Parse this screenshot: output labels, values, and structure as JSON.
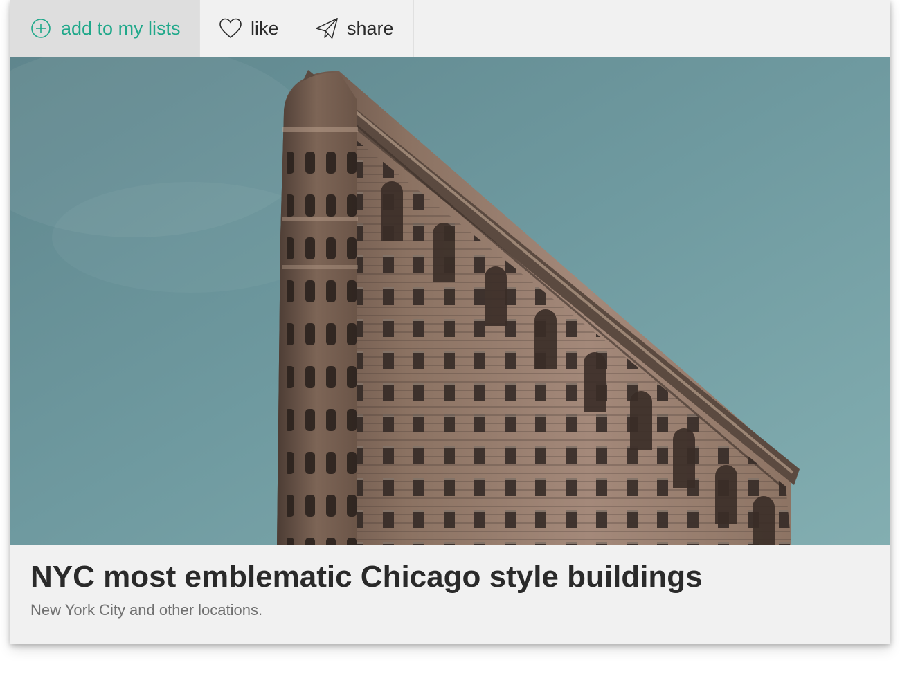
{
  "toolbar": {
    "add_label": "add to my lists",
    "add_icon": "plus-circle-icon",
    "like_label": "like",
    "like_icon": "heart-icon",
    "share_label": "share",
    "share_icon": "paper-plane-icon"
  },
  "colors": {
    "accent": "#1fa88a",
    "card_background": "#f1f1f1",
    "active_tab_background": "#dedede",
    "sky": "#6f9aa0",
    "building": "#8c7363"
  },
  "hero": {
    "alt": "Flatiron Building against a blue sky"
  },
  "caption": {
    "title": "NYC most emblematic Chicago style buildings",
    "subtitle": "New York City and other locations."
  }
}
